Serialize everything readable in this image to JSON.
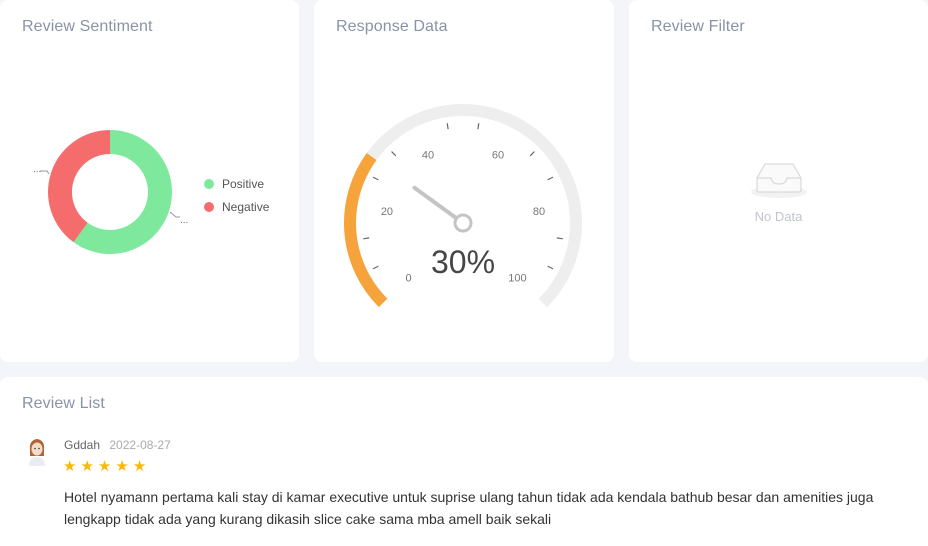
{
  "sentiment": {
    "title": "Review Sentiment",
    "legend": [
      {
        "label": "Positive",
        "color": "#7ee89d"
      },
      {
        "label": "Negative",
        "color": "#f56c6c"
      }
    ],
    "label_positive": "...",
    "label_negative": "..."
  },
  "chart_data": {
    "type": "pie",
    "categories": [
      "Positive",
      "Negative"
    ],
    "values": [
      60,
      40
    ],
    "colors": [
      "#7ee89d",
      "#f56c6c"
    ],
    "donut": true
  },
  "response": {
    "title": "Response Data",
    "value": 30,
    "value_text": "30%",
    "tick_labels": [
      "0",
      "20",
      "40",
      "60",
      "80",
      "100"
    ],
    "min": 0,
    "max": 100,
    "progress_color": "#f5a33a",
    "track_color": "#eeeeee"
  },
  "filter": {
    "title": "Review Filter",
    "empty_text": "No Data"
  },
  "review_list": {
    "title": "Review List",
    "reviews": [
      {
        "author": "Gddah",
        "date": "2022-08-27",
        "rating": 5,
        "text": "Hotel nyamann pertama kali stay di kamar executive untuk suprise ulang tahun tidak ada kendala bathub besar dan amenities juga lengkapp tidak ada yang kurang dikasih slice cake sama mba amell baik sekali"
      }
    ]
  }
}
